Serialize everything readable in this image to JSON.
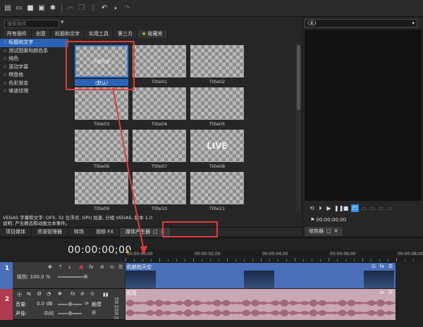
{
  "toolbar": {
    "icons": [
      "new-icon",
      "open-icon",
      "save-icon",
      "save-as-icon",
      "settings-icon",
      "cut-icon",
      "copy-icon",
      "paste-icon",
      "undo-icon",
      "redo-icon"
    ]
  },
  "media_generators": {
    "search_placeholder": "搜索插件",
    "category_tabs": [
      "所有插件",
      "创意",
      "标题和文字",
      "实用工具",
      "第三方"
    ],
    "favorites_tab": "收藏夹",
    "tree": [
      {
        "label": "标题和文字",
        "selected": true
      },
      {
        "label": "测试图案和颜色条",
        "selected": false
      },
      {
        "label": "纯色",
        "selected": false
      },
      {
        "label": "滚动字幕",
        "selected": false
      },
      {
        "label": "棋盘格",
        "selected": false
      },
      {
        "label": "色彩渐变",
        "selected": false
      },
      {
        "label": "噪波纹理",
        "selected": false
      }
    ],
    "thumbs": [
      {
        "caption": "(默认)",
        "text": "示例文本",
        "big": false,
        "selected": true
      },
      {
        "caption": "Title01",
        "text": "",
        "big": false,
        "selected": false
      },
      {
        "caption": "Title02",
        "text": "",
        "big": false,
        "selected": false
      },
      {
        "caption": "Title03",
        "text": "",
        "big": false,
        "selected": false
      },
      {
        "caption": "Title04",
        "text": "",
        "big": false,
        "selected": false
      },
      {
        "caption": "Title05",
        "text": "",
        "big": false,
        "selected": false
      },
      {
        "caption": "Title06",
        "text": "",
        "big": false,
        "selected": false
      },
      {
        "caption": "Title07",
        "text": "",
        "big": false,
        "selected": false
      },
      {
        "caption": "Title08",
        "text": "LIVE",
        "big": true,
        "selected": false
      },
      {
        "caption": "Title09",
        "text": "",
        "big": false,
        "selected": false
      },
      {
        "caption": "Title10",
        "text": "",
        "big": false,
        "selected": false
      },
      {
        "caption": "Title11",
        "text": "",
        "big": false,
        "selected": false
      }
    ],
    "status_line1": "VEGAS 字幕和文字: OFX, 32 位浮点, GPU 加速, 分组 VEGAS, 版本 1.0",
    "status_line2": "说明: 产生静态和动画文本事件。"
  },
  "bottom_tabs": [
    {
      "label": "项目媒体",
      "active": false
    },
    {
      "label": "资源管理器",
      "active": false
    },
    {
      "label": "转场",
      "active": false
    },
    {
      "label": "视频 FX",
      "active": false
    },
    {
      "label": "媒体产生器",
      "active": true
    }
  ],
  "preview": {
    "select_value": "(无)",
    "timecode": "00:00:00;00",
    "tab_label": "修剪器"
  },
  "timeline": {
    "timecode": "00:00:00;00",
    "ruler": [
      "00:00:00;00",
      "00:00:02;00",
      "00:00:04;00",
      "00:00:06;00",
      "00:00:08;00"
    ],
    "video_track": {
      "number": "1",
      "level_label": "级别: 100.0 %",
      "clip_title": "机舱拍天空"
    },
    "audio_track": {
      "number": "2",
      "volume_label": "音量:",
      "volume_value": "0.0 dB",
      "pan_label": "声像:",
      "pan_value": "中间",
      "touch_label": "触摸",
      "clip_title": "配音",
      "scale": [
        "18",
        "36",
        "54",
        "18",
        "36",
        "54"
      ]
    }
  }
}
